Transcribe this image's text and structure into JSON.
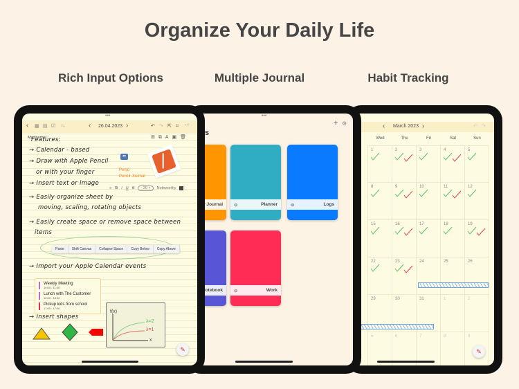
{
  "headline": "Organize Your Daily Life",
  "sections": [
    "Rich Input Options",
    "Multiple Journal",
    "Habit Tracking"
  ],
  "journal": {
    "date": "26.04.2023",
    "name": "My Journal",
    "lines": [
      "Features:",
      "→ Calendar - based",
      "→ Draw with Apple Pencil",
      "or with your finger",
      "→ Insert text or image",
      "→ Easily organize sheet by",
      "moving, scaling, rotating objects",
      "→ Easily create space or remove space between",
      "items",
      "→ Import your Apple Calendar events",
      "→ Insert shapes"
    ],
    "brand": [
      "Penjo",
      "Pencil Journal"
    ],
    "font_toolbar": {
      "size": "20",
      "font": "Noteworthy"
    },
    "context_menu": [
      "Paste",
      "Shift Canvas",
      "Collapse Space",
      "Copy Below",
      "Copy Above"
    ],
    "events": [
      {
        "title": "Weekly Meeting",
        "time": "10:00 - 11:00",
        "color": "#b86bd6"
      },
      {
        "title": "Lunch with The Customer",
        "time": "12:00 - 13:30",
        "color": "#b86bd6"
      },
      {
        "title": "Pickup kids from school",
        "time": "17:00 - 17:30",
        "color": "#e0304a"
      }
    ],
    "graph": {
      "ylabel": "f(x)",
      "xlabel": "x",
      "curves": [
        "λ=2",
        "λ=1"
      ]
    }
  },
  "journals": {
    "title_fragment": "s",
    "cards": [
      {
        "name": "My Journal",
        "color": "#ff9500"
      },
      {
        "name": "Planner",
        "color": "#30adc2"
      },
      {
        "name": "Logs",
        "color": "#0a7aff"
      },
      {
        "name": "Notebook",
        "color": "#5856d6"
      },
      {
        "name": "Work",
        "color": "#ff2d55"
      }
    ]
  },
  "calendar": {
    "month": "March 2023",
    "weekdays": [
      "Wed",
      "Thu",
      "Fri",
      "Sat",
      "Sun"
    ],
    "weeks": [
      [
        "1",
        "2",
        "3",
        "4",
        "5"
      ],
      [
        "8",
        "9",
        "10",
        "11",
        "12"
      ],
      [
        "15",
        "16",
        "17",
        "18",
        "19"
      ],
      [
        "22",
        "23",
        "24",
        "25",
        "26"
      ],
      [
        "29",
        "30",
        "31",
        "1",
        "2"
      ],
      [
        "5",
        "6",
        "7",
        "8",
        "9"
      ]
    ],
    "checks": {
      "1": [
        "green"
      ],
      "2": [
        "green",
        "red"
      ],
      "3": [
        "green"
      ],
      "4": [
        "green",
        "red"
      ],
      "5": [
        "green"
      ],
      "8": [
        "green"
      ],
      "9": [
        "green",
        "red"
      ],
      "10": [
        "green"
      ],
      "11": [
        "green",
        "red"
      ],
      "12": [
        "green"
      ],
      "15": [
        "green"
      ],
      "16": [
        "green",
        "red"
      ],
      "17": [
        "green"
      ],
      "18": [
        "green"
      ],
      "19": [
        "green",
        "red"
      ],
      "22": [
        "green"
      ],
      "23": [
        "green",
        "red"
      ]
    },
    "colors": {
      "green": "#5cc26a",
      "red": "#e0404a"
    }
  }
}
